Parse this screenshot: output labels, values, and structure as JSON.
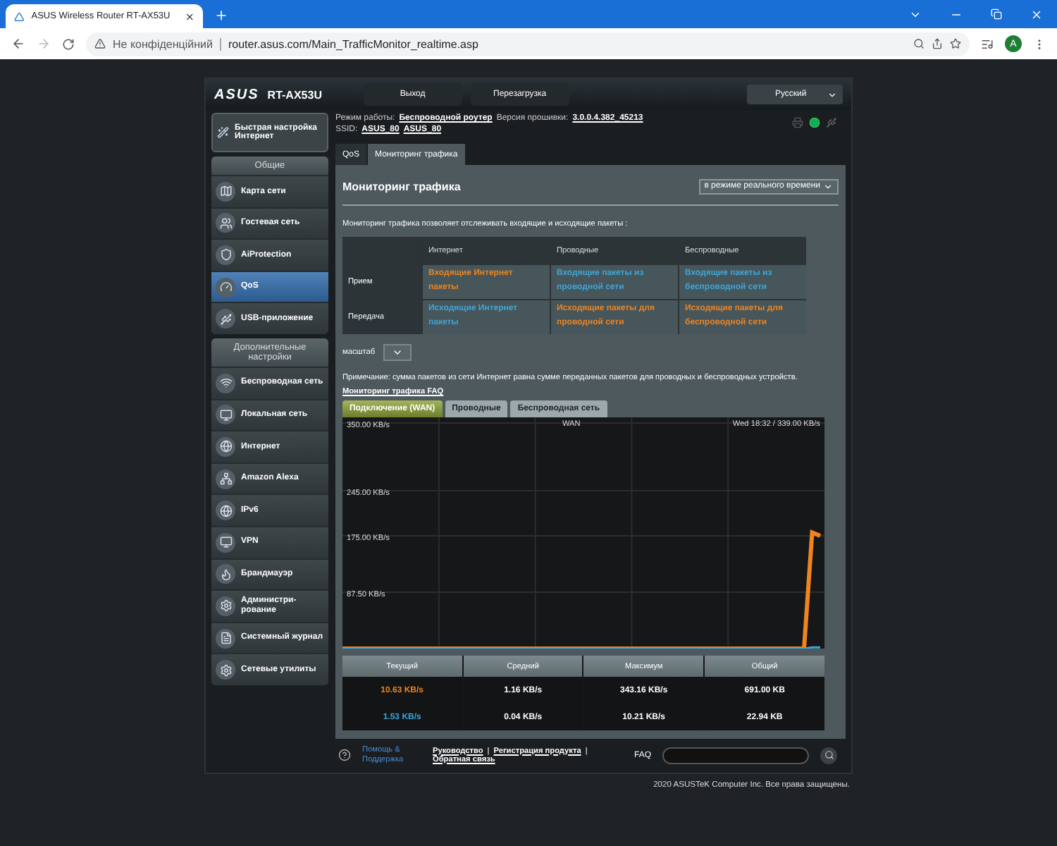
{
  "browser": {
    "tab_title": "ASUS Wireless Router RT-AX53U",
    "security": "Не конфіденційний",
    "url": "router.asus.com/Main_TrafficMonitor_realtime.asp",
    "avatar": "A"
  },
  "header": {
    "logo": "ASUS",
    "model": "RT-AX53U",
    "buttons": [
      "Выход",
      "Перезагрузка"
    ],
    "language": "Русский"
  },
  "info": {
    "mode_label": "Режим работы:",
    "mode": "Беспроводной роутер",
    "firmware_label": "Версия прошивки:",
    "firmware": "3.0.0.4.382_45213",
    "ssid_label": "SSID:",
    "ssids": [
      "ASUS_80",
      "ASUS_80"
    ]
  },
  "sidebar": {
    "quick_setup": "Быстрая настройка Интернет",
    "sections": [
      {
        "title": "Общие",
        "items": [
          {
            "label": "Карта сети",
            "selected": false
          },
          {
            "label": "Гостевая сеть",
            "selected": false
          },
          {
            "label": "AiProtection",
            "selected": false
          },
          {
            "label": "QoS",
            "selected": true
          },
          {
            "label": "USB-приложение",
            "selected": false
          }
        ]
      },
      {
        "title": "Дополнительные настройки",
        "items": [
          {
            "label": "Беспроводная сеть",
            "selected": false
          },
          {
            "label": "Локальная сеть",
            "selected": false
          },
          {
            "label": "Интернет",
            "selected": false
          },
          {
            "label": "Amazon Alexa",
            "selected": false
          },
          {
            "label": "IPv6",
            "selected": false
          },
          {
            "label": "VPN",
            "selected": false
          },
          {
            "label": "Брандмауэр",
            "selected": false
          },
          {
            "label": "Администри-рование",
            "selected": false
          },
          {
            "label": "Системный журнал",
            "selected": false
          },
          {
            "label": "Сетевые утилиты",
            "selected": false
          }
        ]
      }
    ]
  },
  "page_tabs": [
    {
      "label": "QoS",
      "selected": false
    },
    {
      "label": "Мониторинг трафика",
      "selected": true
    }
  ],
  "panel": {
    "title": "Мониторинг трафика",
    "mode_select": "в режиме реального времени",
    "description": "Мониторинг трафика позволяет отслеживать входящие и исходящие пакеты :",
    "legend": {
      "columns": [
        "Интернет",
        "Проводные",
        "Беспроводные"
      ],
      "rows": [
        {
          "label": "Прием",
          "cells": [
            {
              "text": "Входящие Интернет пакеты",
              "kind": "download"
            },
            {
              "text": "Входящие пакеты из проводной сети",
              "kind": "upload"
            },
            {
              "text": "Входящие пакеты из беспроводной сети",
              "kind": "upload"
            }
          ]
        },
        {
          "label": "Передача",
          "cells": [
            {
              "text": "Исходящие Интернет пакеты",
              "kind": "upload"
            },
            {
              "text": "Исходящие пакеты для проводной сети",
              "kind": "download"
            },
            {
              "text": "Исходящие пакеты для беспроводной сети",
              "kind": "download"
            }
          ]
        }
      ]
    },
    "scale_label": "масштаб",
    "note": "Примечание: сумма пакетов из сети Интернет равна сумме переданных пакетов для проводных и беспроводных устройств.",
    "faq_link": "Мониторинг трафика FAQ",
    "chart_tabs": [
      {
        "label": "Подключение (WAN)",
        "selected": true
      },
      {
        "label": "Проводные",
        "selected": false
      },
      {
        "label": "Беспроводная сеть",
        "selected": false
      }
    ],
    "chart_data": {
      "type": "line",
      "title": "WAN",
      "grid": true,
      "ylim": [
        0,
        350
      ],
      "yticks": [
        {
          "value": 350,
          "label": "350.00 KB/s"
        },
        {
          "value": 245,
          "label": "245.00 KB/s"
        },
        {
          "value": 175,
          "label": "175.00 KB/s"
        },
        {
          "value": 87.5,
          "label": "87.50 KB/s"
        }
      ],
      "annotations": [
        "Wed 18:32 / 339.00 KB/s"
      ],
      "series": [
        {
          "color": "#f0841e",
          "values": [
            0,
            0,
            0,
            0,
            0,
            0,
            0,
            0,
            0,
            0,
            0,
            0,
            0,
            0,
            0,
            0,
            0,
            0,
            0,
            0,
            0,
            0,
            0,
            0,
            0,
            0,
            0,
            0,
            0,
            0,
            0,
            0,
            0,
            0,
            0,
            0,
            0,
            0,
            0,
            0,
            0,
            0,
            0,
            0,
            0,
            0,
            0,
            0,
            0,
            0,
            0,
            0,
            0,
            0,
            0,
            0,
            0,
            0,
            180,
            175
          ]
        },
        {
          "color": "#3fa6d8",
          "values": [
            0,
            0,
            0,
            0,
            0,
            0,
            0,
            0,
            0,
            0,
            0,
            0,
            0,
            0,
            0,
            0,
            0,
            0,
            0,
            0,
            0,
            0,
            0,
            0,
            0,
            0,
            0,
            0,
            0,
            0,
            0,
            0,
            0,
            0,
            0,
            0,
            0,
            0,
            0,
            0,
            0,
            0,
            0,
            0,
            0,
            0,
            0,
            0,
            0,
            0,
            0,
            0,
            0,
            0,
            0,
            0,
            0,
            0,
            2,
            2
          ]
        }
      ]
    },
    "stats": {
      "columns": [
        "Текущий",
        "Средний",
        "Максимум",
        "Общий"
      ],
      "rows": [
        {
          "kind": "download",
          "cells": [
            "10.63 KB/s",
            "1.16 KB/s",
            "343.16 KB/s",
            "691.00 KB"
          ]
        },
        {
          "kind": "upload",
          "cells": [
            "1.53 KB/s",
            "0.04 KB/s",
            "10.21 KB/s",
            "22.94 KB"
          ]
        }
      ]
    }
  },
  "footer": {
    "help": "Помощь & Поддержка",
    "links": [
      "Руководство",
      "Регистрация продукта",
      "Обратная связь"
    ],
    "separator": "|",
    "faq": "FAQ"
  },
  "copyright": "2020 ASUSTeK Computer Inc. Все права защищены."
}
